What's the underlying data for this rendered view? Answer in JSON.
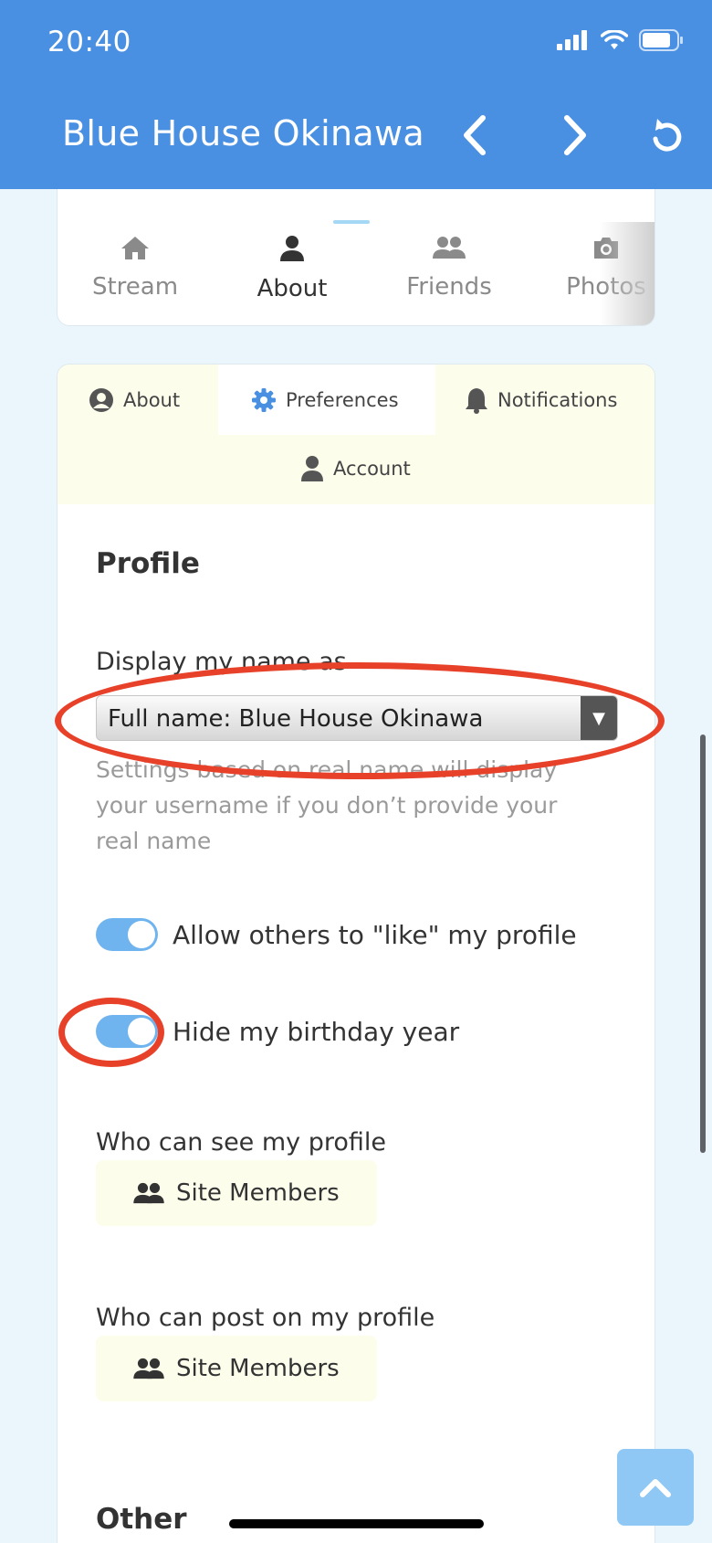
{
  "status_bar": {
    "time": "20:40"
  },
  "header": {
    "title": "Blue House Okinawa"
  },
  "tabs": [
    {
      "label": "Stream"
    },
    {
      "label": "About"
    },
    {
      "label": "Friends"
    },
    {
      "label": "Photos"
    }
  ],
  "subtabs": [
    {
      "label": "About"
    },
    {
      "label": "Preferences"
    },
    {
      "label": "Notifications"
    },
    {
      "label": "Account"
    }
  ],
  "profile": {
    "section_title": "Profile",
    "display_name_label": "Display my name as",
    "display_name_value": "Full name: Blue House Okinawa",
    "help_text": "Settings based on real name will display your username if you don’t provide your real name",
    "toggles": [
      {
        "label": "Allow others to \"like\" my profile",
        "on": true
      },
      {
        "label": "Hide my birthday year",
        "on": true
      }
    ],
    "who_can_see_label": "Who can see my profile",
    "who_can_see_value": "Site Members",
    "who_can_post_label": "Who can post on my profile",
    "who_can_post_value": "Site Members"
  },
  "other": {
    "section_title": "Other"
  },
  "colors": {
    "header": "#4a90e2",
    "annotation": "#e8412a",
    "toggle_on": "#6fb4ef"
  }
}
